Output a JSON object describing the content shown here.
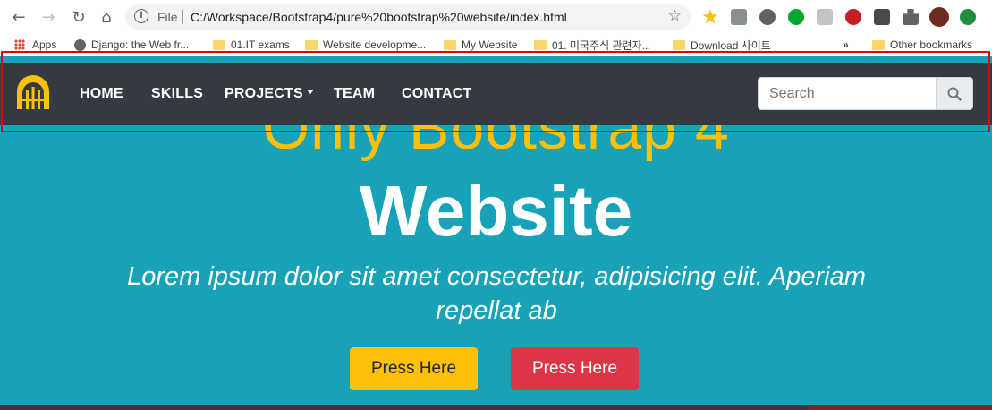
{
  "browser": {
    "scheme_label": "File",
    "url": "C:/Workspace/Bootstrap4/pure%20bootstrap%20website/index.html",
    "bookmarks": [
      {
        "label": "Apps"
      },
      {
        "label": "Django: the Web fr..."
      },
      {
        "label": "01.IT exams"
      },
      {
        "label": "Website developme..."
      },
      {
        "label": "My Website"
      },
      {
        "label": "01. 미국주식 관련자..."
      },
      {
        "label": "Download 사이트"
      }
    ],
    "overflow_label": "»",
    "other_bookmarks": "Other bookmarks"
  },
  "navbar": {
    "links": [
      {
        "label": "HOME"
      },
      {
        "label": "SKILLS"
      },
      {
        "label": "PROJECTS"
      },
      {
        "label": "TEAM"
      },
      {
        "label": "CONTACT"
      }
    ],
    "search_placeholder": "Search"
  },
  "hero": {
    "subtitle": "Only Bootstrap 4",
    "title": "Website",
    "lead": "Lorem ipsum dolor sit amet consectetur, adipisicing elit. Aperiam repellat ab",
    "button_primary": "Press Here",
    "button_secondary": "Press Here"
  },
  "colors": {
    "navbar_bg": "#343a40",
    "hero_bg": "#17a2b8",
    "accent_yellow": "#ffc107",
    "accent_red": "#dc3545",
    "highlight": "#e8000b"
  }
}
